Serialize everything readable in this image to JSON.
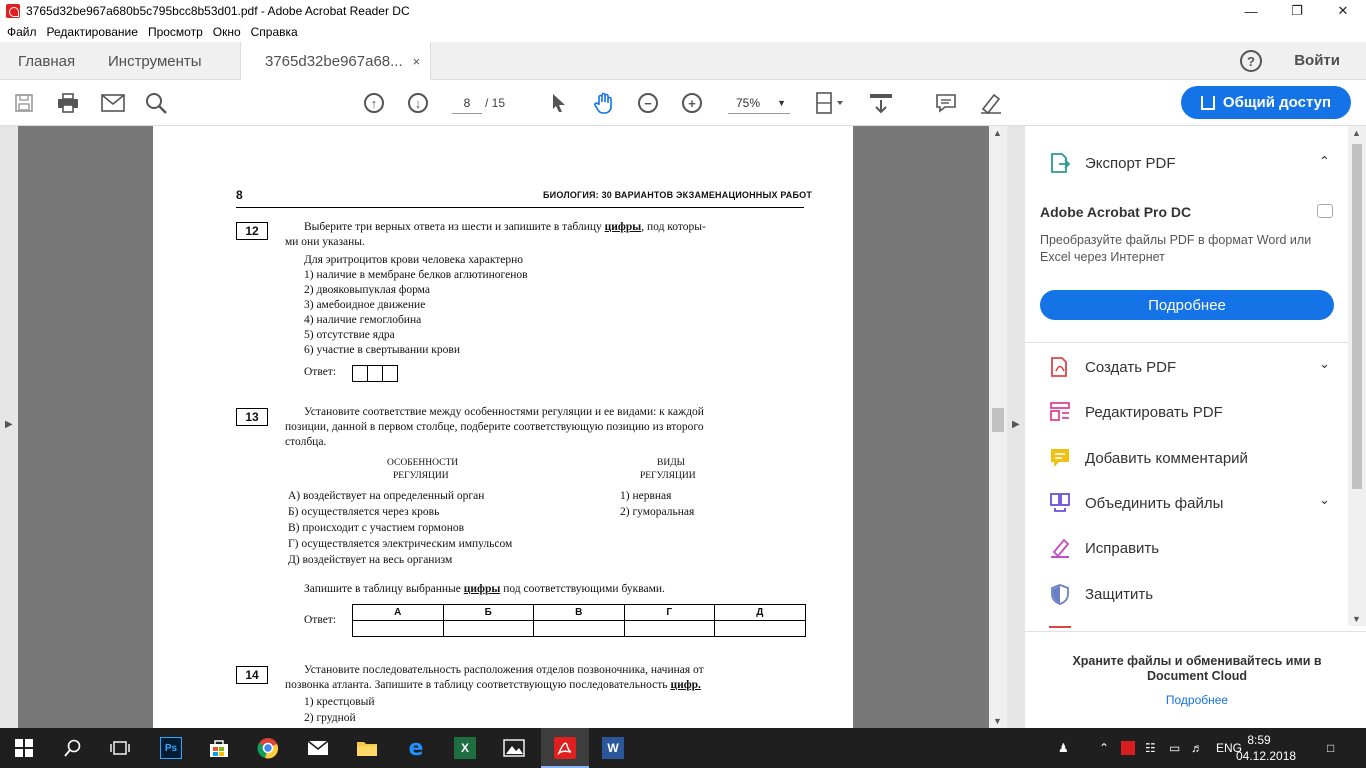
{
  "window": {
    "title": "3765d32be967a680b5c795bcc8b53d01.pdf - Adobe Acrobat Reader DC"
  },
  "menu": [
    "Файл",
    "Редактирование",
    "Просмотр",
    "Окно",
    "Справка"
  ],
  "tabs": {
    "home": "Главная",
    "tools": "Инструменты",
    "document": "3765d32be967a68...",
    "close": "×"
  },
  "account": {
    "help": "?",
    "signin": "Войти"
  },
  "toolbar": {
    "page_current": "8",
    "page_total": "/ 15",
    "zoom": "75%",
    "share": "Общий доступ"
  },
  "page": {
    "number": "8",
    "header": "БИОЛОГИЯ: 30 ВАРИАНТОВ ЭКЗАМЕНАЦИОННЫХ РАБОТ",
    "q12": {
      "num": "12",
      "line1a": "Выберите три верных ответа из шести и запишите в таблицу ",
      "line1b": "цифры",
      "line1c": ", под которы-",
      "line2": "ми они указаны.",
      "intro": "Для эритроцитов крови человека характерно",
      "options": [
        "1) наличие в мембране белков аглютиногенов",
        "2) двояковыпуклая форма",
        "3) амебоидное движение",
        "4) наличие гемоглобина",
        "5) отсутствие ядра",
        "6) участие в свертывании крови"
      ],
      "answer": "Ответ:"
    },
    "q13": {
      "num": "13",
      "line1": "Установите соответствие между особенностями регуляции и ее видами: к каждой",
      "line2": "позиции, данной в первом столбце, подберите соответствующую позицию из второго",
      "line3": "столбца.",
      "col1_h1": "ОСОБЕННОСТИ",
      "col1_h2": "РЕГУЛЯЦИИ",
      "col2_h1": "ВИДЫ",
      "col2_h2": "РЕГУЛЯЦИИ",
      "left": [
        "А) воздействует на определенный орган",
        "Б) осуществляется через кровь",
        "В) происходит с участием гормонов",
        "Г) осуществляется электрическим импульсом",
        "Д) воздействует на весь организм"
      ],
      "right": [
        "1) нервная",
        "2) гуморальная"
      ],
      "write_a": "Запишите в таблицу выбранные ",
      "write_b": "цифры",
      "write_c": " под соответствующими буквами.",
      "answer": "Ответ:",
      "letters": [
        "А",
        "Б",
        "В",
        "Г",
        "Д"
      ]
    },
    "q14": {
      "num": "14",
      "line1": "Установите последовательность расположения отделов позвоночника, начиная от",
      "line2a": "позвонка атланта. Запишите в таблицу соответствующую последовательность ",
      "line2b": "цифр.",
      "options": [
        "1) крестцовый",
        "2) грудной"
      ]
    }
  },
  "sidebar": {
    "export": "Экспорт PDF",
    "ad_title": "Adobe Acrobat Pro DC",
    "ad_desc": "Преобразуйте файлы PDF в формат Word или Excel через Интернет",
    "more": "Подробнее",
    "items": [
      "Создать PDF",
      "Редактировать PDF",
      "Добавить комментарий",
      "Объединить файлы",
      "Исправить",
      "Защитить"
    ],
    "cloud": "Храните файлы и обменивайтесь ими в Document Cloud",
    "cloud_link": "Подробнее"
  },
  "taskbar": {
    "lang": "ENG",
    "time": "8:59",
    "date": "04.12.2018"
  },
  "colors": {
    "accent": "#1473e6",
    "acrobat_red": "#e01f1f"
  }
}
